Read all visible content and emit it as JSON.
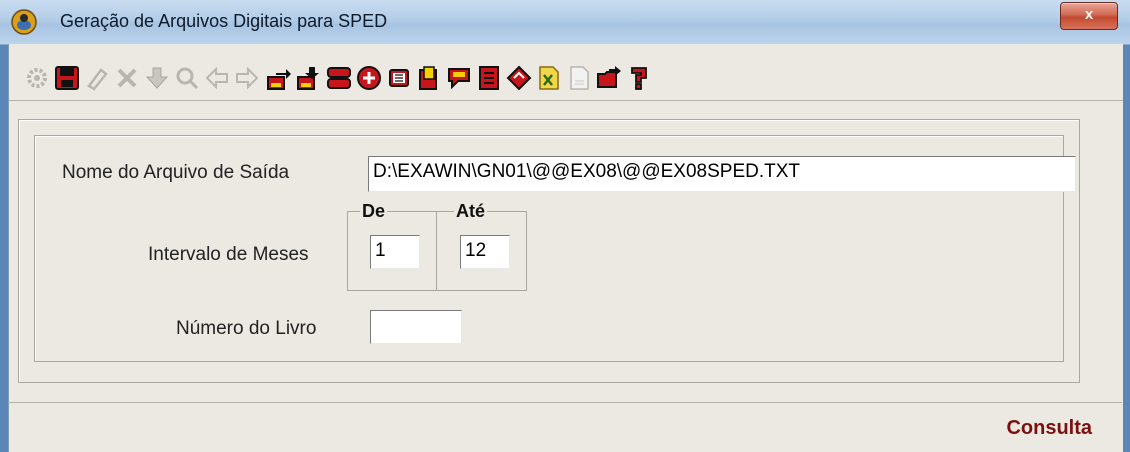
{
  "window": {
    "title": "Geração de Arquivos Digitais para SPED",
    "close_label": "x"
  },
  "toolbar": {
    "icons": [
      "gear-icon",
      "save-icon",
      "edit-icon",
      "cancel-icon",
      "down-arrow-icon",
      "search-icon",
      "left-arrow-icon",
      "right-arrow-icon",
      "export-icon",
      "import-icon",
      "rows-icon",
      "add-icon",
      "calculator-icon",
      "document-icon",
      "comment-icon",
      "list-icon",
      "diamond-icon",
      "excel-icon",
      "page-icon",
      "folder-arrow-icon",
      "help-icon"
    ]
  },
  "form": {
    "output_file_label": "Nome do Arquivo de Saída",
    "output_file_value": "D:\\EXAWIN\\GN01\\@@EX08\\@@EX08SPED.TXT",
    "months_label": "Intervalo de Meses",
    "from_caption": "De",
    "to_caption": "Até",
    "from_value": "1",
    "to_value": "12",
    "book_label": "Número do Livro",
    "book_value": ""
  },
  "status": {
    "mode": "Consulta"
  },
  "colors": {
    "accent_red": "#c8151c",
    "status_text": "#7a1010"
  }
}
